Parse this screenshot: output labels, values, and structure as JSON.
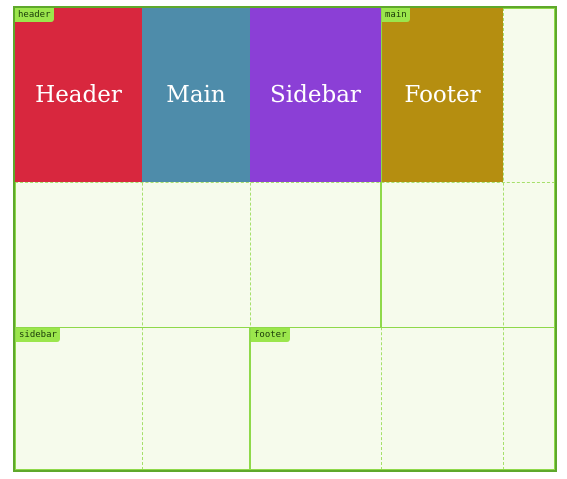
{
  "grid": {
    "area_labels": {
      "header": "header",
      "main": "main",
      "sidebar": "sidebar",
      "footer": "footer"
    },
    "items": [
      {
        "label": "Header",
        "color": "#d8273e"
      },
      {
        "label": "Main",
        "color": "#4e8caa"
      },
      {
        "label": "Sidebar",
        "color": "#8b3fd6"
      },
      {
        "label": "Footer",
        "color": "#b58e10"
      }
    ],
    "colors": {
      "background": "#f6fbec",
      "outer_border": "#5ea82b",
      "area_border": "#8fd94a",
      "dashed_line": "#a6e06b",
      "label_bg": "#9be64c"
    }
  }
}
